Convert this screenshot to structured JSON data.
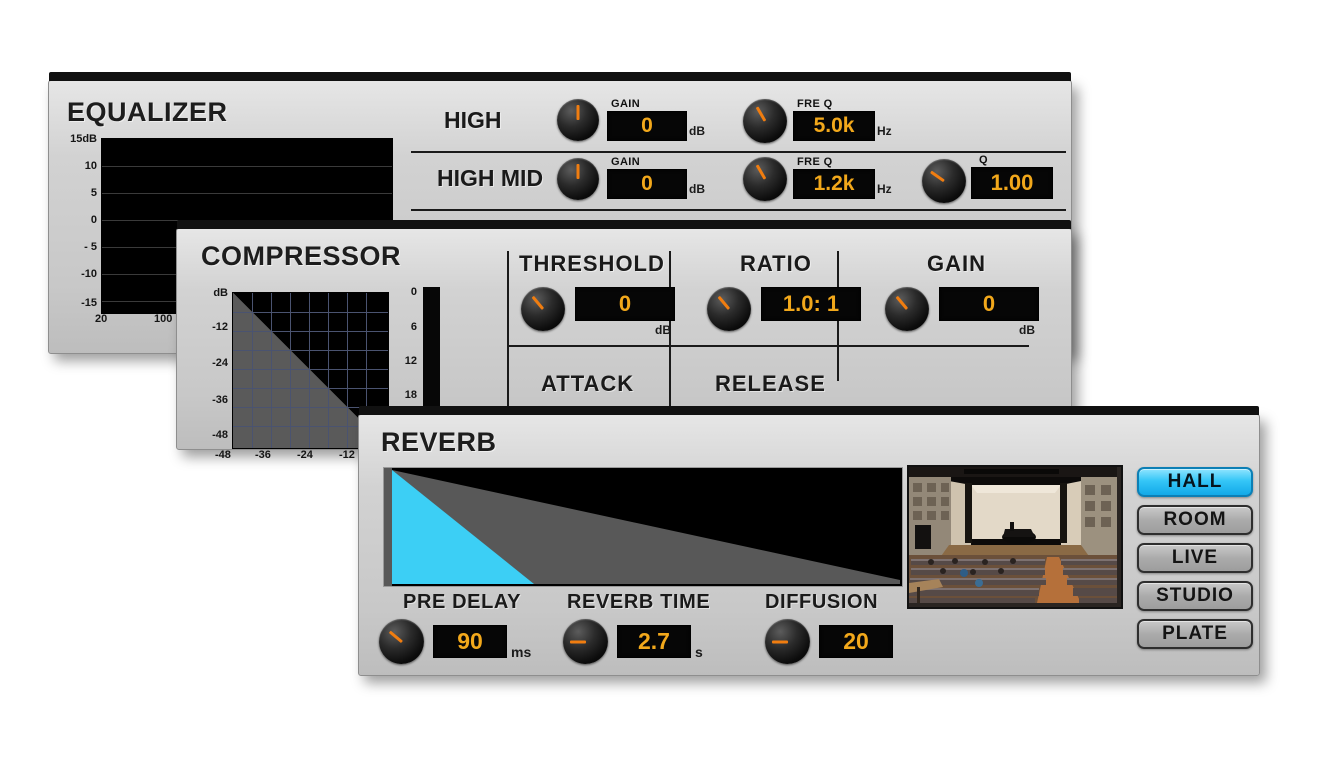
{
  "equalizer": {
    "title": "EQUALIZER",
    "graph": {
      "y_ticks": [
        "15dB",
        "10",
        "5",
        "0",
        "- 5",
        "-10",
        "-15"
      ],
      "x_ticks": [
        "20",
        "100"
      ]
    },
    "bands": [
      {
        "name": "HIGH",
        "gain_label": "GAIN",
        "gain_value": "0",
        "gain_unit": "dB",
        "gain_knob_angle": 0,
        "freq_label": "FRE Q",
        "freq_value": "5.0k",
        "freq_unit": "Hz",
        "freq_knob_angle": -30
      },
      {
        "name": "HIGH MID",
        "gain_label": "GAIN",
        "gain_value": "0",
        "gain_unit": "dB",
        "gain_knob_angle": 0,
        "freq_label": "FRE Q",
        "freq_value": "1.2k",
        "freq_unit": "Hz",
        "freq_knob_angle": -30,
        "q_label": "Q",
        "q_value": "1.00",
        "q_knob_angle": -55
      }
    ]
  },
  "compressor": {
    "title": "COMPRESSOR",
    "graph": {
      "y_ticks": [
        "dB",
        "-12",
        "-24",
        "-36",
        "-48"
      ],
      "x_ticks": [
        "-48",
        "-36",
        "-24",
        "-12"
      ]
    },
    "meter": {
      "ticks": [
        "0",
        "6",
        "12",
        "18"
      ]
    },
    "controls": [
      {
        "name": "THRESHOLD",
        "value": "0",
        "unit": "dB",
        "knob_angle": -40
      },
      {
        "name": "RATIO",
        "value": "1.0: 1",
        "unit": "",
        "knob_angle": -40
      },
      {
        "name": "GAIN",
        "value": "0",
        "unit": "dB",
        "knob_angle": -40
      },
      {
        "name": "ATTACK",
        "value": "",
        "unit": "",
        "knob_angle": -40
      },
      {
        "name": "RELEASE",
        "value": "",
        "unit": "",
        "knob_angle": -40
      }
    ]
  },
  "reverb": {
    "title": "REVERB",
    "graph": {
      "early_color": "#3ccff5",
      "tail_color": "#585858"
    },
    "controls": [
      {
        "name": "PRE DELAY",
        "value": "90",
        "unit": "ms",
        "knob_angle": -50
      },
      {
        "name": "REVERB TIME",
        "value": "2.7",
        "unit": "s",
        "knob_angle": -90
      },
      {
        "name": "DIFFUSION",
        "value": "20",
        "unit": "",
        "knob_angle": -90
      }
    ],
    "presets": [
      {
        "label": "HALL",
        "active": true
      },
      {
        "label": "ROOM",
        "active": false
      },
      {
        "label": "LIVE",
        "active": false
      },
      {
        "label": "STUDIO",
        "active": false
      },
      {
        "label": "PLATE",
        "active": false
      }
    ],
    "photo_alt": "concert-hall"
  },
  "colors": {
    "lcd_text": "#f2a81b",
    "knob_pointer": "#f07d10",
    "active_preset": "#35c6f7",
    "panel_face": "#d2d2d2"
  }
}
